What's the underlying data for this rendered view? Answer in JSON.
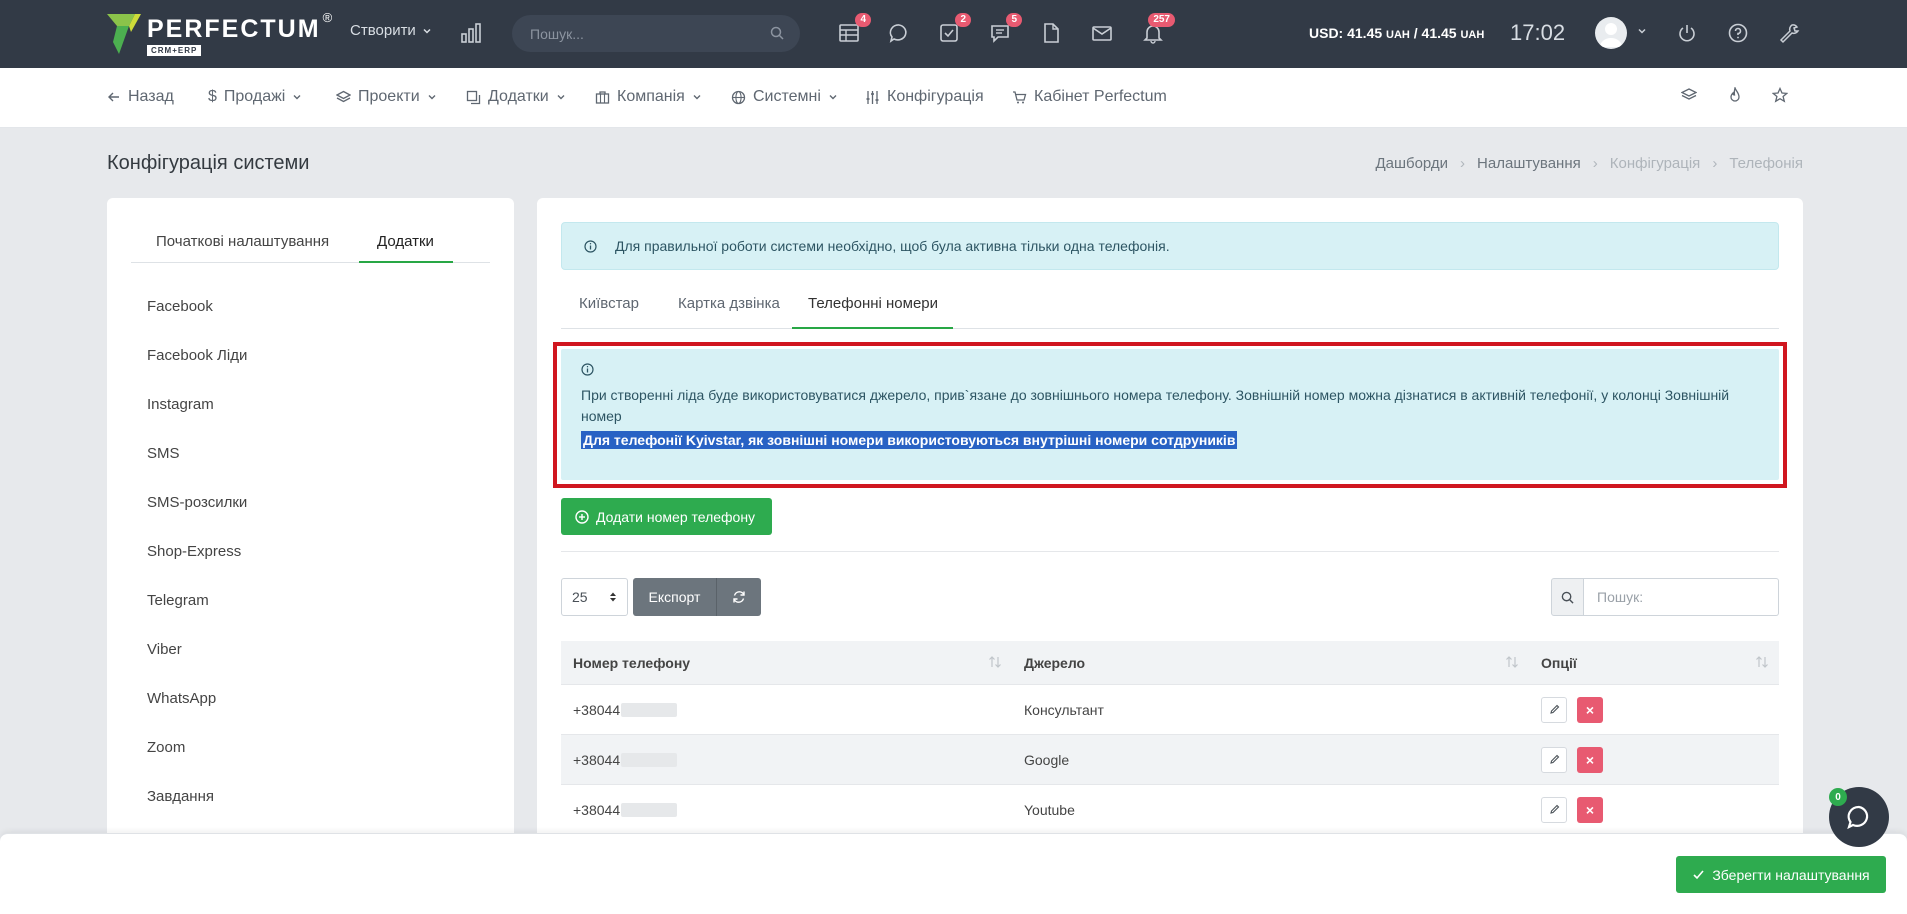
{
  "topbar": {
    "logo_word": "PERFECTUM",
    "logo_sub": "CRM+ERP",
    "logo_reg": "®",
    "create_label": "Створити",
    "search_placeholder": "Пошук...",
    "badges": {
      "calendar": "4",
      "tasks": "2",
      "chat": "5",
      "notifications": "257"
    },
    "rate_prefix": "USD: 41.45 ",
    "rate_unit1": "UAH",
    "rate_mid": " / 41.45 ",
    "rate_unit2": "UAH",
    "clock": "17:02"
  },
  "menu": {
    "back": "Назад",
    "sales": "Продажі",
    "projects": "Проекти",
    "addons": "Додатки",
    "company": "Компанія",
    "system": "Системні",
    "config": "Конфігурація",
    "cabinet": "Кабінет Perfectum"
  },
  "page": {
    "title": "Конфігурація системи",
    "breadcrumb": [
      "Дашборди",
      "Налаштування",
      "Конфігурація",
      "Телефонія"
    ]
  },
  "left": {
    "tabs": [
      "Початкові налаштування",
      "Додатки"
    ],
    "items": [
      "Facebook",
      "Facebook Ліди",
      "Instagram",
      "SMS",
      "SMS-розсилки",
      "Shop-Express",
      "Telegram",
      "Viber",
      "WhatsApp",
      "Zoom",
      "Завдання"
    ]
  },
  "right": {
    "alert_top": "Для правильної роботи системи необхідно, щоб була активна тільки одна телефонія.",
    "tabs": [
      "Київстар",
      "Картка дзвінка",
      "Телефонні номери"
    ],
    "info_text": "При створенні ліда буде використовуватися джерело, прив`язане до зовнішнього номера телефону. Зовнішній номер можна дізнатися в активній телефонії, у колонці Зовнішній номер",
    "info_highlight": "Для телефонії Kyivstar, як зовнішні номери використовуються внутрішні номери сотдруників",
    "add_button": "Додати номер телефону",
    "per_page": "25",
    "export_label": "Експорт",
    "search_placeholder": "Пошук:",
    "table": {
      "headers": [
        "Номер телефону",
        "Джерело",
        "Опції"
      ],
      "rows": [
        {
          "phone": "+38044",
          "source": "Консультант"
        },
        {
          "phone": "+38044",
          "source": "Google"
        },
        {
          "phone": "+38044",
          "source": "Youtube"
        }
      ]
    }
  },
  "footer": {
    "save_label": "Зберегти налаштування"
  },
  "chat": {
    "badge": "0"
  },
  "colors": {
    "topbar": "#323a46",
    "accent_green": "#2eab4f",
    "info_bg": "#d7f1f5",
    "danger": "#e85a71",
    "highlight_box": "#d0161f"
  }
}
